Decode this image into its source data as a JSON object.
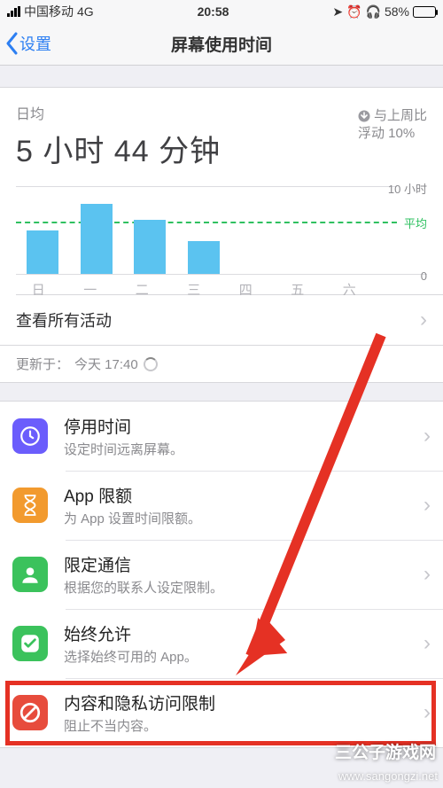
{
  "status": {
    "carrier": "中国移动",
    "network": "4G",
    "time": "20:58",
    "battery_pct": "58%"
  },
  "nav": {
    "back_label": "设置",
    "title": "屏幕使用时间"
  },
  "summary": {
    "avg_label": "日均",
    "avg_value": "5 小时 44 分钟",
    "delta_line1": "与上周比",
    "delta_line2": "浮动 10%",
    "delta_direction": "down"
  },
  "chart_data": {
    "type": "bar",
    "categories": [
      "日",
      "一",
      "二",
      "三",
      "四",
      "五",
      "六"
    ],
    "values_hours": [
      5,
      8,
      6.2,
      3.7,
      0,
      0,
      0
    ],
    "ylim": [
      0,
      10
    ],
    "y_max_label": "10 小时",
    "y_min_label": "0",
    "avg_label": "平均",
    "avg_value_hours": 5.73
  },
  "actions": {
    "see_all": "查看所有活动",
    "updated_prefix": "更新于：",
    "updated_at": "今天 17:40"
  },
  "list": [
    {
      "key": "downtime",
      "title": "停用时间",
      "sub": "设定时间远离屏幕。",
      "icon_color": "#6b5dfc",
      "icon_name": "clock-pause-icon"
    },
    {
      "key": "app_limits",
      "title": "App 限额",
      "sub": "为 App 设置时间限额。",
      "icon_color": "#f29a2e",
      "icon_name": "hourglass-icon"
    },
    {
      "key": "communication",
      "title": "限定通信",
      "sub": "根据您的联系人设定限制。",
      "icon_color": "#3bc25c",
      "icon_name": "contact-icon"
    },
    {
      "key": "always_allowed",
      "title": "始终允许",
      "sub": "选择始终可用的 App。",
      "icon_color": "#3bc25c",
      "icon_name": "check-shield-icon"
    },
    {
      "key": "content_privacy",
      "title": "内容和隐私访问限制",
      "sub": "阻止不当内容。",
      "icon_color": "#e74c3c",
      "icon_name": "no-entry-icon"
    }
  ],
  "annotation": {
    "highlight_row_key": "content_privacy",
    "arrow_color": "#e53124"
  },
  "watermark": {
    "brand": "三公子游戏网",
    "site": "www.sangongzi.net"
  }
}
